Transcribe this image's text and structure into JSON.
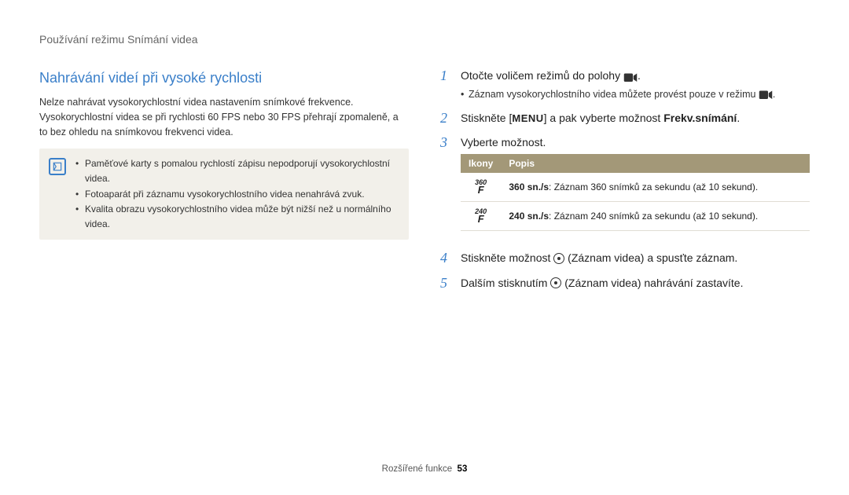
{
  "header": "Používání režimu Snímání videa",
  "section_title": "Nahrávání videí při vysoké rychlosti",
  "intro": "Nelze nahrávat vysokorychlostní videa nastavením snímkové frekvence. Vysokorychlostní videa se při rychlosti 60 FPS nebo 30 FPS přehrají zpomaleně, a to bez ohledu na snímkovou frekvenci videa.",
  "info": {
    "items": [
      "Paměťové karty s pomalou rychlostí zápisu nepodporují vysokorychlostní videa.",
      "Fotoaparát při záznamu vysokorychlostního videa nenahrává zvuk.",
      "Kvalita obrazu vysokorychlostního videa může být nižší než u normálního videa."
    ]
  },
  "steps": {
    "s1": {
      "text_a": "Otočte voličem režimů do polohy ",
      "text_b": ".",
      "sub_a": "Záznam vysokorychlostního videa můžete provést pouze v režimu ",
      "sub_b": "."
    },
    "s2": {
      "text_a": "Stiskněte [",
      "menu": "MENU",
      "text_b": "] a pak vyberte možnost ",
      "bold": "Frekv.snímání",
      "text_c": "."
    },
    "s3": {
      "text": "Vyberte možnost."
    },
    "s4": {
      "text_a": "Stiskněte možnost ",
      "text_b": " (Záznam videa) a spusťte záznam."
    },
    "s5": {
      "text_a": "Dalším stisknutím ",
      "text_b": " (Záznam videa) nahrávání zastavíte."
    }
  },
  "table": {
    "headers": {
      "icon": "Ikony",
      "desc": "Popis"
    },
    "rows": [
      {
        "icon_top": "360",
        "icon_f": "F",
        "bold": "360 sn./s",
        "rest": ": Záznam 360 snímků za sekundu (až 10 sekund)."
      },
      {
        "icon_top": "240",
        "icon_f": "F",
        "bold": "240 sn./s",
        "rest": ": Záznam 240 snímků za sekundu (až 10 sekund)."
      }
    ]
  },
  "footer": {
    "label": "Rozšířené funkce",
    "page": "53"
  }
}
